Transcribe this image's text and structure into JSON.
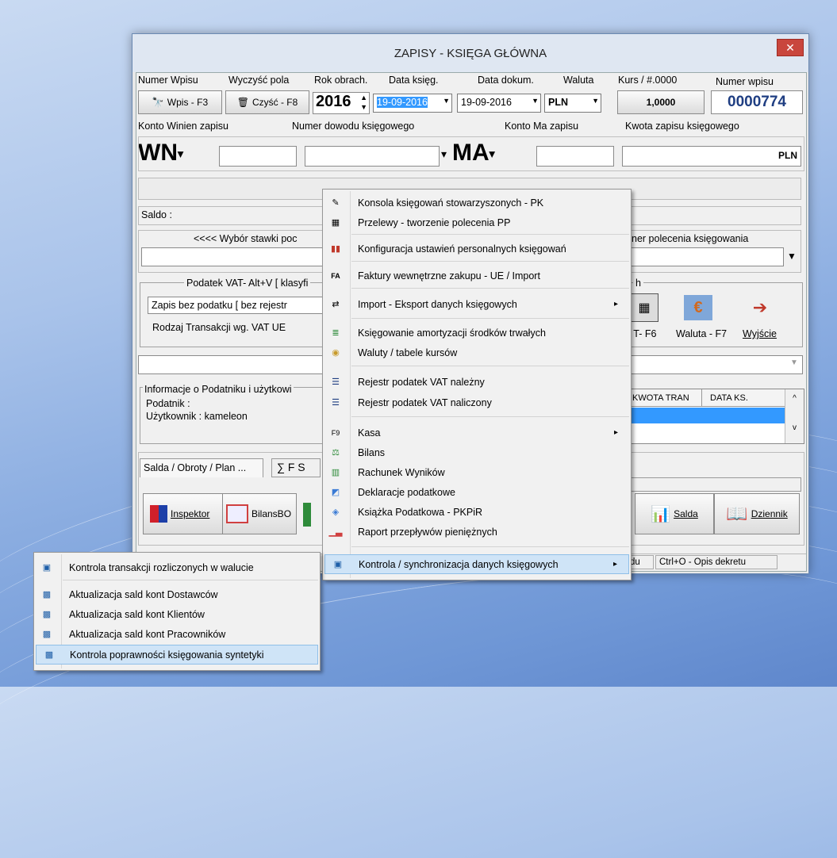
{
  "window": {
    "title": "ZAPISY - KSIĘGA GŁÓWNA",
    "close": "✕"
  },
  "header": {
    "numer_wpisu_label": "Numer Wpisu",
    "wyczysc_label": "Wyczyść pola",
    "rok_label": "Rok obrach.",
    "data_ksieg_label": "Data księg.",
    "data_dokum_label": "Data dokum.",
    "waluta_label": "Waluta",
    "kurs_label": "Kurs / #.0000",
    "numer_wpisu2_label": "Numer wpisu"
  },
  "row2": {
    "wpis_btn": "Wpis - F3",
    "czysc_btn": "Czyść - F8",
    "rok": "2016",
    "data_ksieg": "19-09-2016",
    "data_dokum": "19-09-2016",
    "waluta": "PLN",
    "kurs": "1,0000",
    "numer": "0000774"
  },
  "row3": {
    "konto_winien": "Konto  Winien  zapisu",
    "numer_dowodu": "Numer dowodu księgowego",
    "konto_ma": "Konto   Ma   zapisu",
    "kwota": "Kwota zapisu księgowego"
  },
  "row4": {
    "wn": "WN",
    "ma": "MA",
    "currency": "PLN"
  },
  "saldo": {
    "label": "Saldo :"
  },
  "stawka": {
    "label": "<<<<  Wybór stawki poc",
    "right_label": "ner polecenia księgowania"
  },
  "vat": {
    "title": "Podatek VAT- Alt+V [ klasyfi",
    "value": "Zapis bez podatku [ bez rejestr",
    "rodzaj": "Rodzaj Transakcji wg. VAT UE"
  },
  "tools": {
    "group_title": "h",
    "t_f6": "ki T- F6",
    "waluta_f7": "Waluta - F7",
    "wyjscie": "Wyjście"
  },
  "info": {
    "title": "Informacje o Podatniku i użytkowi",
    "podatnik": "Podatnik    :",
    "uzytkownik": "Użytkownik  : kameleon"
  },
  "grid": {
    "col1": "KWOTA TRAN",
    "col2": "DATA KS."
  },
  "tabs": {
    "salda": "Salda / Obroty / Plan ...",
    "sigma": "∑ F S"
  },
  "bottom_buttons": {
    "inspektor": "Inspektor",
    "bilansbo": "BilansBO",
    "salda": "Salda",
    "dziennik": "Dziennik"
  },
  "status": {
    "s1": "du",
    "s2": "Ctrl+O - Opis dekretu"
  },
  "main_menu": {
    "items": [
      {
        "label": "Konsola księgowań stowarzyszonych - PK",
        "icon": "console-icon"
      },
      {
        "label": "Przelewy - tworzenie polecenia PP",
        "icon": "transfer-icon"
      },
      {
        "label": "Konfiguracja ustawień personalnych księgowań",
        "icon": "config-icon"
      },
      {
        "label": "Faktury wewnętrzne zakupu - UE / Import",
        "icon": "invoice-icon"
      },
      {
        "label": "Import - Eksport danych księgowych",
        "icon": "import-icon",
        "arrow": "▸"
      },
      {
        "label": "Księgowanie amortyzacji środków trwałych",
        "icon": "amort-icon"
      },
      {
        "label": "Waluty / tabele kursów",
        "icon": "currency-icon"
      },
      {
        "label": "Rejestr podatek VAT należny",
        "icon": "register-icon"
      },
      {
        "label": "Rejestr podatek VAT naliczony",
        "icon": "register-icon"
      },
      {
        "label": "Kasa",
        "icon": "cash-icon",
        "arrow": "▸"
      },
      {
        "label": "Bilans",
        "icon": "balance-icon"
      },
      {
        "label": "Rachunek Wyników",
        "icon": "results-icon"
      },
      {
        "label": "Deklaracje podatkowe",
        "icon": "declaration-icon"
      },
      {
        "label": "Książka Podatkowa - PKPiR",
        "icon": "book-icon"
      },
      {
        "label": "Raport przepływów pieniężnych",
        "icon": "report-icon"
      },
      {
        "label": "Kontrola / synchronizacja danych księgowych",
        "icon": "sync-icon",
        "arrow": "▸"
      }
    ]
  },
  "sub_menu": {
    "items": [
      {
        "label": "Kontrola transakcji rozliczonych w walucie"
      },
      {
        "label": "Aktualizacja sald kont Dostawców"
      },
      {
        "label": "Aktualizacja sald kont Klientów"
      },
      {
        "label": "Aktualizacja sald kont Pracowników"
      },
      {
        "label": "Kontrola poprawności księgowania syntetyki"
      }
    ]
  },
  "colors": {
    "accent": "#1f5fa8",
    "highlight": "#cfe4f7",
    "selection": "#3399ff"
  }
}
